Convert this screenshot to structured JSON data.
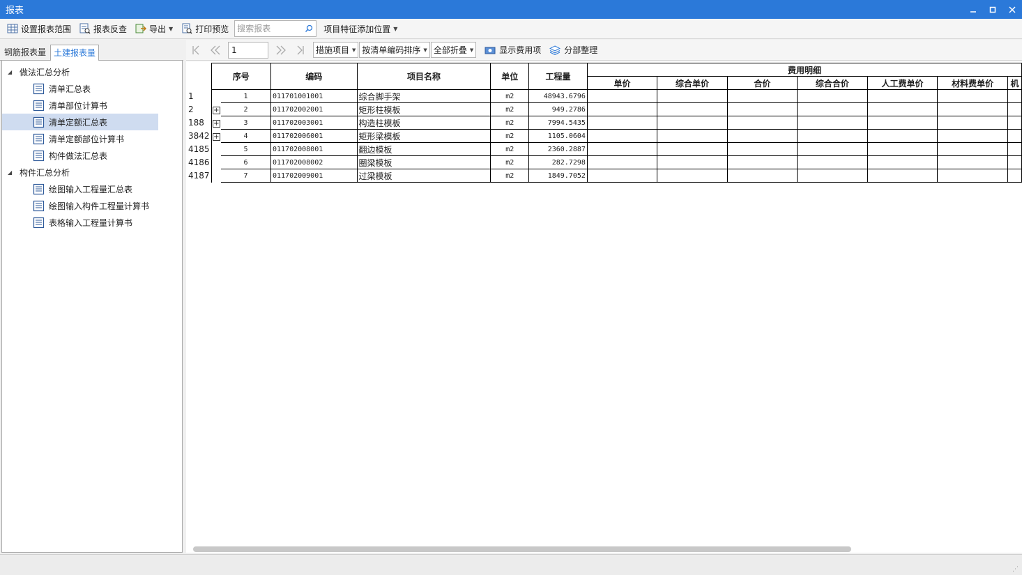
{
  "window": {
    "title": "报表",
    "controls": [
      "minimize",
      "maximize",
      "close"
    ]
  },
  "toolbar": {
    "set_scope": "设置报表范围",
    "reverse_check": "报表反查",
    "export": "导出",
    "print_preview": "打印预览",
    "search_placeholder": "搜索报表",
    "feature_position": "项目特征添加位置"
  },
  "left": {
    "tabs": [
      {
        "label": "钢筋报表量",
        "active": false
      },
      {
        "label": "土建报表量",
        "active": true
      }
    ],
    "groups": [
      {
        "label": "做法汇总分析",
        "expanded": true,
        "items": [
          {
            "label": "清单汇总表",
            "selected": false
          },
          {
            "label": "清单部位计算书",
            "selected": false
          },
          {
            "label": "清单定额汇总表",
            "selected": true
          },
          {
            "label": "清单定额部位计算书",
            "selected": false
          },
          {
            "label": "构件做法汇总表",
            "selected": false
          }
        ]
      },
      {
        "label": "构件汇总分析",
        "expanded": true,
        "items": [
          {
            "label": "绘图输入工程量汇总表",
            "selected": false
          },
          {
            "label": "绘图输入构件工程量计算书",
            "selected": false
          },
          {
            "label": "表格输入工程量计算书",
            "selected": false
          }
        ]
      }
    ]
  },
  "nav": {
    "page": "1",
    "filter": "措施项目",
    "sort": "按清单编码排序",
    "fold": "全部折叠",
    "show_fee": "显示费用项",
    "section_arrange": "分部整理"
  },
  "table": {
    "headers": {
      "seq": "序号",
      "code": "编码",
      "name": "项目名称",
      "unit": "单位",
      "quantity": "工程量",
      "fee_detail": "费用明细",
      "fee_cols": [
        "单价",
        "综合单价",
        "合价",
        "综合合价",
        "人工费单价",
        "材料费单价",
        "机"
      ]
    },
    "rows": [
      {
        "rownum": "1",
        "expandable": false,
        "seq": "1",
        "code": "011701001001",
        "name": "综合脚手架",
        "unit": "m2",
        "quantity": "48943.6796"
      },
      {
        "rownum": "2",
        "expandable": true,
        "seq": "2",
        "code": "011702002001",
        "name": "矩形柱模板",
        "unit": "m2",
        "quantity": "949.2786"
      },
      {
        "rownum": "188",
        "expandable": true,
        "seq": "3",
        "code": "011702003001",
        "name": "构造柱模板",
        "unit": "m2",
        "quantity": "7994.5435"
      },
      {
        "rownum": "3842",
        "expandable": true,
        "seq": "4",
        "code": "011702006001",
        "name": "矩形梁模板",
        "unit": "m2",
        "quantity": "1105.0604"
      },
      {
        "rownum": "4185",
        "expandable": false,
        "seq": "5",
        "code": "011702008001",
        "name": "翻边模板",
        "unit": "m2",
        "quantity": "2360.2887"
      },
      {
        "rownum": "4186",
        "expandable": false,
        "seq": "6",
        "code": "011702008002",
        "name": "圈梁模板",
        "unit": "m2",
        "quantity": "282.7298"
      },
      {
        "rownum": "4187",
        "expandable": false,
        "seq": "7",
        "code": "011702009001",
        "name": "过梁模板",
        "unit": "m2",
        "quantity": "1849.7052"
      }
    ]
  },
  "colors": {
    "titlebar": "#2b79d9",
    "selection": "#cfdcf0",
    "active_tab_text": "#2b79d9"
  }
}
